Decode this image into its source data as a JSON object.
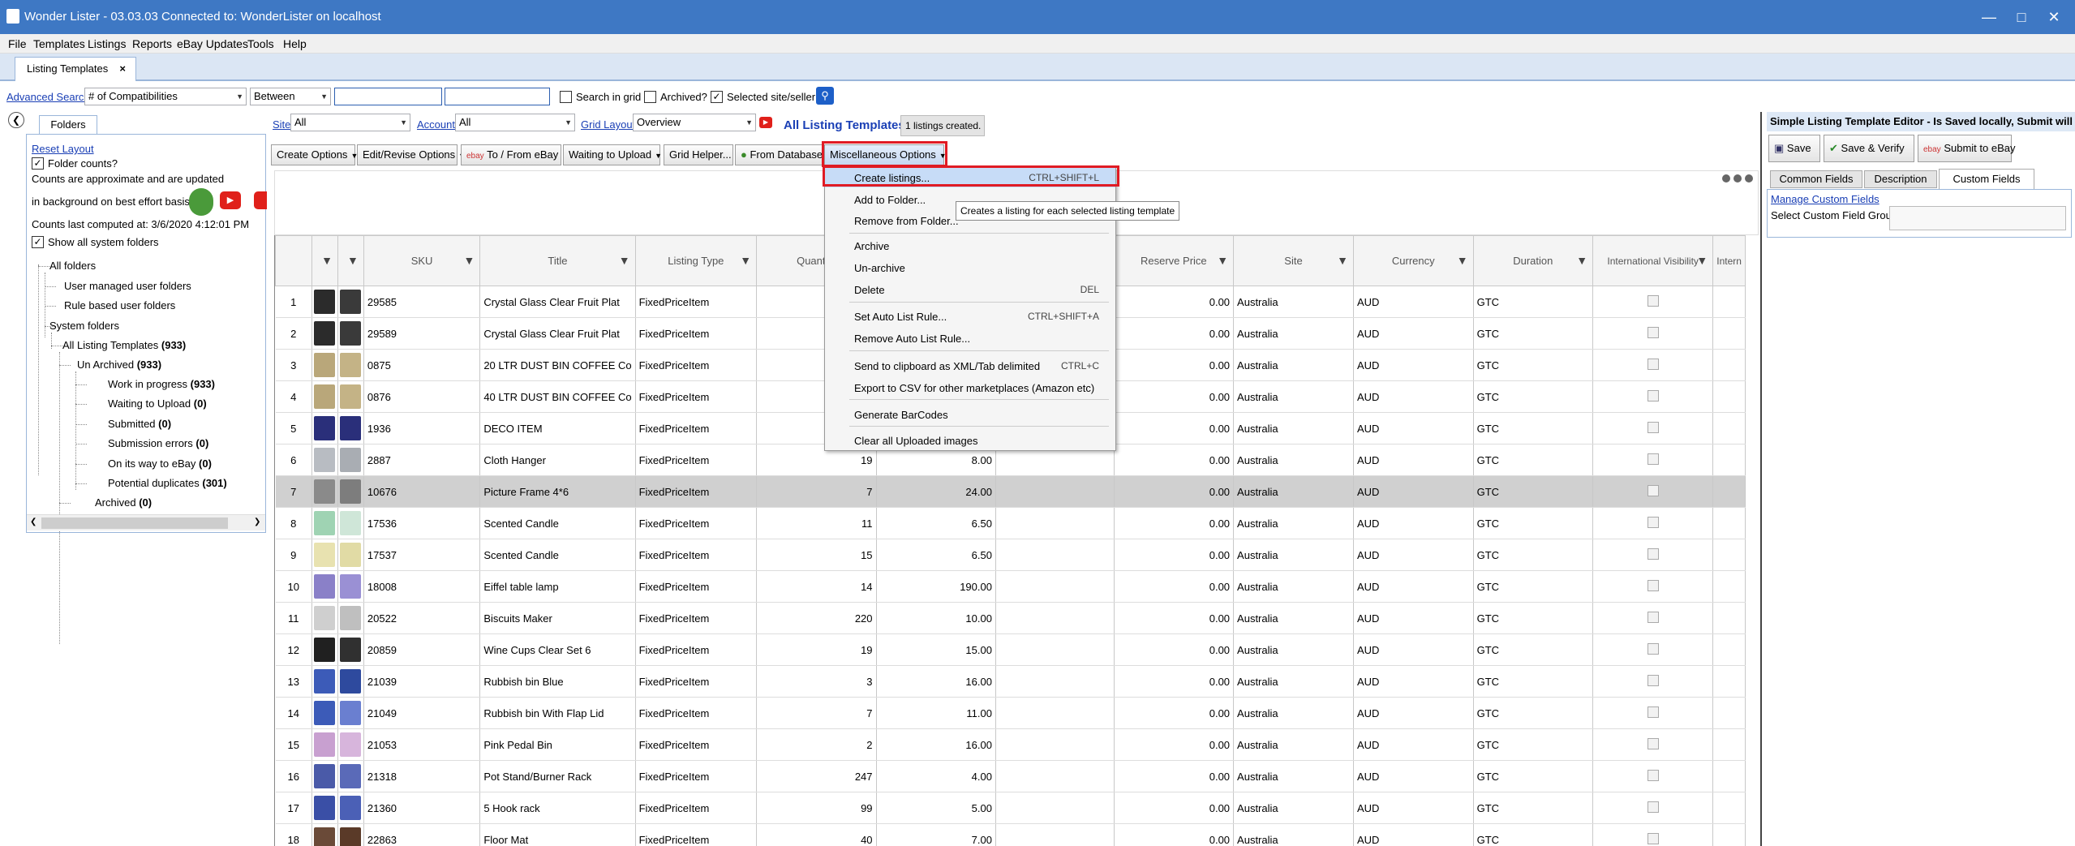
{
  "window": {
    "title": "Wonder Lister - 03.03.03 Connected to: WonderLister on localhost"
  },
  "menu_bar": [
    "File",
    "Templates",
    "Listings",
    "Reports",
    "eBay Updates",
    "Tools",
    "Help"
  ],
  "doc_tab": {
    "label": "Listing Templates",
    "close": "×"
  },
  "search": {
    "advanced_label": "Advanced Search",
    "field": "# of Compatibilities",
    "operator": "Between",
    "search_in_grid": "Search in grid",
    "archived": "Archived?",
    "selected_site": "Selected site/seller"
  },
  "folders": {
    "tab": "Folders",
    "reset_layout": "Reset Layout",
    "folder_counts": "Folder counts?",
    "note1": "Counts are approximate and are updated",
    "note2": "in background on best effort basis",
    "computed": "Counts last computed at: 3/6/2020 4:12:01 PM",
    "show_system": "Show all system folders",
    "tree": {
      "all": "All folders",
      "user_managed": "User managed user folders",
      "rule_based": "Rule based user folders",
      "system": "System folders",
      "all_templates": "All Listing Templates",
      "all_templates_count": "(933)",
      "unarchived": "Un Archived",
      "unarchived_count": "(933)",
      "wip": "Work in progress",
      "wip_count": "(933)",
      "waiting": "Waiting to Upload",
      "waiting_count": "(0)",
      "submitted": "Submitted",
      "submitted_count": "(0)",
      "errors": "Submission errors",
      "errors_count": "(0)",
      "on_way": "On its way to eBay",
      "on_way_count": "(0)",
      "duplicates": "Potential duplicates",
      "duplicates_count": "(301)",
      "archived": "Archived",
      "archived_count": "(0)"
    }
  },
  "filters": {
    "site_label": "Site",
    "site_value": "All",
    "account_label": "Account",
    "account_value": "All",
    "layout_label": "Grid Layout",
    "layout_value": "Overview",
    "heading": "All Listing Templates",
    "status": "1 listings created."
  },
  "toolbar": {
    "create": "Create Options",
    "edit": "Edit/Revise Options",
    "to_from": "To / From eBay",
    "waiting": "Waiting to Upload",
    "grid_helper": "Grid Helper...",
    "from_db": "From Database",
    "misc": "Miscellaneous Options"
  },
  "dropdown": {
    "create": "Create listings...",
    "create_sc": "CTRL+SHIFT+L",
    "add_folder": "Add to Folder...",
    "remove_folder": "Remove from Folder...",
    "archive": "Archive",
    "unarchive": "Un-archive",
    "delete": "Delete",
    "delete_sc": "DEL",
    "set_rule": "Set Auto List Rule...",
    "set_rule_sc": "CTRL+SHIFT+A",
    "remove_rule": "Remove Auto List Rule...",
    "clipboard": "Send to clipboard as XML/Tab delimited",
    "clipboard_sc": "CTRL+C",
    "export": "Export to CSV for other marketplaces (Amazon etc)",
    "barcodes": "Generate BarCodes",
    "clear_images": "Clear all Uploaded images",
    "tooltip": "Creates a listing for each selected listing template"
  },
  "columns": [
    "SKU",
    "Title",
    "Listing Type",
    "Quantity",
    "Reserve Price",
    "Site",
    "Currency",
    "Duration",
    "International Visibility",
    "Intern"
  ],
  "rows": [
    {
      "n": "1",
      "sku": "29585",
      "title": "Crystal Glass Clear Fruit Plat",
      "type": "FixedPriceItem",
      "qty": "",
      "price": "",
      "reserve": "0.00",
      "site": "Australia",
      "cur": "AUD",
      "dur": "GTC",
      "c1": "#2b2b2b",
      "c2": "#3a3a3a"
    },
    {
      "n": "2",
      "sku": "29589",
      "title": "Crystal Glass Clear Fruit Plat",
      "type": "FixedPriceItem",
      "qty": "",
      "price": "",
      "reserve": "0.00",
      "site": "Australia",
      "cur": "AUD",
      "dur": "GTC",
      "c1": "#2b2b2b",
      "c2": "#3a3a3a"
    },
    {
      "n": "3",
      "sku": "0875",
      "title": "20 LTR DUST BIN COFFEE Co",
      "type": "FixedPriceItem",
      "qty": "",
      "price": "",
      "reserve": "0.00",
      "site": "Australia",
      "cur": "AUD",
      "dur": "GTC",
      "c1": "#b9a77a",
      "c2": "#c4b386"
    },
    {
      "n": "4",
      "sku": "0876",
      "title": "40 LTR DUST BIN COFFEE Co",
      "type": "FixedPriceItem",
      "qty": "",
      "price": "",
      "reserve": "0.00",
      "site": "Australia",
      "cur": "AUD",
      "dur": "GTC",
      "c1": "#b9a77a",
      "c2": "#c4b386"
    },
    {
      "n": "5",
      "sku": "1936",
      "title": "DECO ITEM",
      "type": "FixedPriceItem",
      "qty": "",
      "price": "",
      "reserve": "0.00",
      "site": "Australia",
      "cur": "AUD",
      "dur": "GTC",
      "c1": "#2a2f7a",
      "c2": "#2a2f7a"
    },
    {
      "n": "6",
      "sku": "2887",
      "title": "Cloth Hanger",
      "type": "FixedPriceItem",
      "qty": "19",
      "price": "8.00",
      "reserve": "0.00",
      "site": "Australia",
      "cur": "AUD",
      "dur": "GTC",
      "c1": "#b8bcc2",
      "c2": "#a9adb3"
    },
    {
      "n": "7",
      "sku": "10676",
      "title": "Picture Frame 4*6",
      "type": "FixedPriceItem",
      "qty": "7",
      "price": "24.00",
      "reserve": "0.00",
      "site": "Australia",
      "cur": "AUD",
      "dur": "GTC",
      "c1": "#8a8a8a",
      "c2": "#7d7d7d"
    },
    {
      "n": "8",
      "sku": "17536",
      "title": "Scented Candle",
      "type": "FixedPriceItem",
      "qty": "11",
      "price": "6.50",
      "reserve": "0.00",
      "site": "Australia",
      "cur": "AUD",
      "dur": "GTC",
      "c1": "#9fd3b3",
      "c2": "#cfe6d8"
    },
    {
      "n": "9",
      "sku": "17537",
      "title": "Scented Candle",
      "type": "FixedPriceItem",
      "qty": "15",
      "price": "6.50",
      "reserve": "0.00",
      "site": "Australia",
      "cur": "AUD",
      "dur": "GTC",
      "c1": "#e8e2b0",
      "c2": "#e1dba5"
    },
    {
      "n": "10",
      "sku": "18008",
      "title": "Eiffel table lamp",
      "type": "FixedPriceItem",
      "qty": "14",
      "price": "190.00",
      "reserve": "0.00",
      "site": "Australia",
      "cur": "AUD",
      "dur": "GTC",
      "c1": "#8a80c8",
      "c2": "#9a90d4"
    },
    {
      "n": "11",
      "sku": "20522",
      "title": "Biscuits Maker",
      "type": "FixedPriceItem",
      "qty": "220",
      "price": "10.00",
      "reserve": "0.00",
      "site": "Australia",
      "cur": "AUD",
      "dur": "GTC",
      "c1": "#cfcfcf",
      "c2": "#bfbfbf"
    },
    {
      "n": "12",
      "sku": "20859",
      "title": "Wine Cups Clear Set 6",
      "type": "FixedPriceItem",
      "qty": "19",
      "price": "15.00",
      "reserve": "0.00",
      "site": "Australia",
      "cur": "AUD",
      "dur": "GTC",
      "c1": "#202020",
      "c2": "#303030"
    },
    {
      "n": "13",
      "sku": "21039",
      "title": "Rubbish bin Blue",
      "type": "FixedPriceItem",
      "qty": "3",
      "price": "16.00",
      "reserve": "0.00",
      "site": "Australia",
      "cur": "AUD",
      "dur": "GTC",
      "c1": "#3c5bb8",
      "c2": "#2e4a9e"
    },
    {
      "n": "14",
      "sku": "21049",
      "title": "Rubbish bin With Flap Lid",
      "type": "FixedPriceItem",
      "qty": "7",
      "price": "11.00",
      "reserve": "0.00",
      "site": "Australia",
      "cur": "AUD",
      "dur": "GTC",
      "c1": "#3c5bb8",
      "c2": "#6a7fd0"
    },
    {
      "n": "15",
      "sku": "21053",
      "title": "Pink Pedal Bin",
      "type": "FixedPriceItem",
      "qty": "2",
      "price": "16.00",
      "reserve": "0.00",
      "site": "Australia",
      "cur": "AUD",
      "dur": "GTC",
      "c1": "#c8a0d0",
      "c2": "#d7b5dc"
    },
    {
      "n": "16",
      "sku": "21318",
      "title": "Pot Stand/Burner Rack",
      "type": "FixedPriceItem",
      "qty": "247",
      "price": "4.00",
      "reserve": "0.00",
      "site": "Australia",
      "cur": "AUD",
      "dur": "GTC",
      "c1": "#4a5aa8",
      "c2": "#5a6ab8"
    },
    {
      "n": "17",
      "sku": "21360",
      "title": "5 Hook rack",
      "type": "FixedPriceItem",
      "qty": "99",
      "price": "5.00",
      "reserve": "0.00",
      "site": "Australia",
      "cur": "AUD",
      "dur": "GTC",
      "c1": "#3a4fa6",
      "c2": "#4b60b6"
    },
    {
      "n": "18",
      "sku": "22863",
      "title": "Floor Mat",
      "type": "FixedPriceItem",
      "qty": "40",
      "price": "7.00",
      "reserve": "0.00",
      "site": "Australia",
      "cur": "AUD",
      "dur": "GTC",
      "c1": "#6a4a38",
      "c2": "#5a3a28"
    }
  ],
  "editor": {
    "title": "Simple Listing Template Editor - Is Saved locally, Submit will creat",
    "save": "Save",
    "save_verify": "Save & Verify",
    "submit": "Submit to eBay",
    "tabs": [
      "Common Fields",
      "Description",
      "Custom Fields"
    ],
    "manage": "Manage Custom Fields",
    "group_label": "Select Custom Field Group:"
  }
}
